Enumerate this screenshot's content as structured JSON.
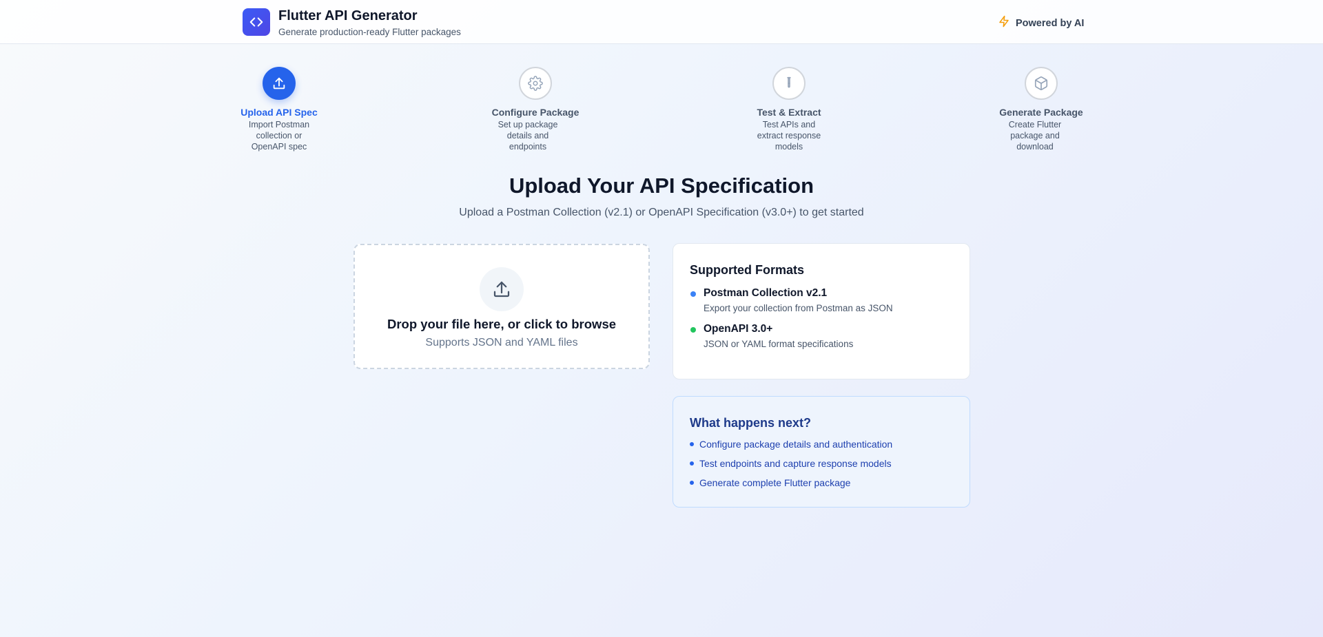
{
  "header": {
    "app_title": "Flutter API Generator",
    "app_subtitle": "Generate production-ready Flutter packages",
    "logo_icon": "code-brackets-icon",
    "powered_label": "Powered by AI",
    "powered_icon": "lightning-icon",
    "powered_icon_color": "#f59e0b"
  },
  "stepper": {
    "active_index": 0,
    "steps": [
      {
        "title": "Upload API Spec",
        "description": "Import Postman collection or OpenAPI spec",
        "icon": "upload-icon"
      },
      {
        "title": "Configure Package",
        "description": "Set up package details and endpoints",
        "icon": "gear-icon"
      },
      {
        "title": "Test & Extract",
        "description": "Test APIs and extract response models",
        "icon": "test-tube-icon"
      },
      {
        "title": "Generate Package",
        "description": "Create Flutter package and download",
        "icon": "package-icon"
      }
    ]
  },
  "main": {
    "title": "Upload Your API Specification",
    "subtitle": "Upload a Postman Collection (v2.1) or OpenAPI Specification (v3.0+) to get started"
  },
  "dropzone": {
    "title": "Drop your file here, or click to browse",
    "subtitle": "Supports JSON and YAML files",
    "icon": "upload-icon"
  },
  "formats": {
    "title": "Supported Formats",
    "items": [
      {
        "name": "Postman Collection v2.1",
        "description": "Export your collection from Postman as JSON",
        "color": "#3b82f6"
      },
      {
        "name": "OpenAPI 3.0+",
        "description": "JSON or YAML format specifications",
        "color": "#22c55e"
      }
    ]
  },
  "next_steps": {
    "title": "What happens next?",
    "items": [
      "Configure package details and authentication",
      "Test endpoints and capture response models",
      "Generate complete Flutter package"
    ]
  },
  "colors": {
    "primary": "#2563eb",
    "brand": "#4f46e5"
  }
}
